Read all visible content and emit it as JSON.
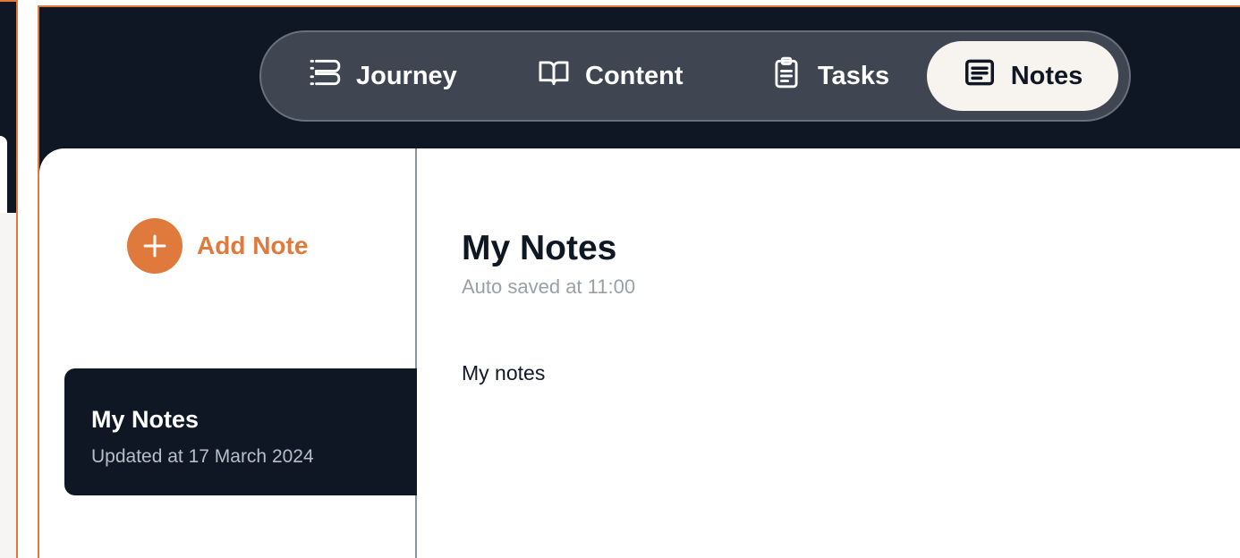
{
  "nav": {
    "items": [
      {
        "label": "Journey",
        "icon": "journey-icon"
      },
      {
        "label": "Content",
        "icon": "book-icon"
      },
      {
        "label": "Tasks",
        "icon": "clipboard-icon"
      },
      {
        "label": "Notes",
        "icon": "notes-icon",
        "active": true
      }
    ]
  },
  "sidebar": {
    "add_note_label": "Add Note",
    "notes": [
      {
        "title": "My Notes",
        "updated": "Updated at 17 March 2024",
        "selected": true
      }
    ]
  },
  "editor": {
    "title": "My Notes",
    "saved_status": "Auto saved at 11:00",
    "content": "My notes"
  },
  "colors": {
    "accent": "#e07a3c",
    "dark": "#0f1724",
    "pill": "#3f4652",
    "active_pill": "#f7f4ef"
  }
}
